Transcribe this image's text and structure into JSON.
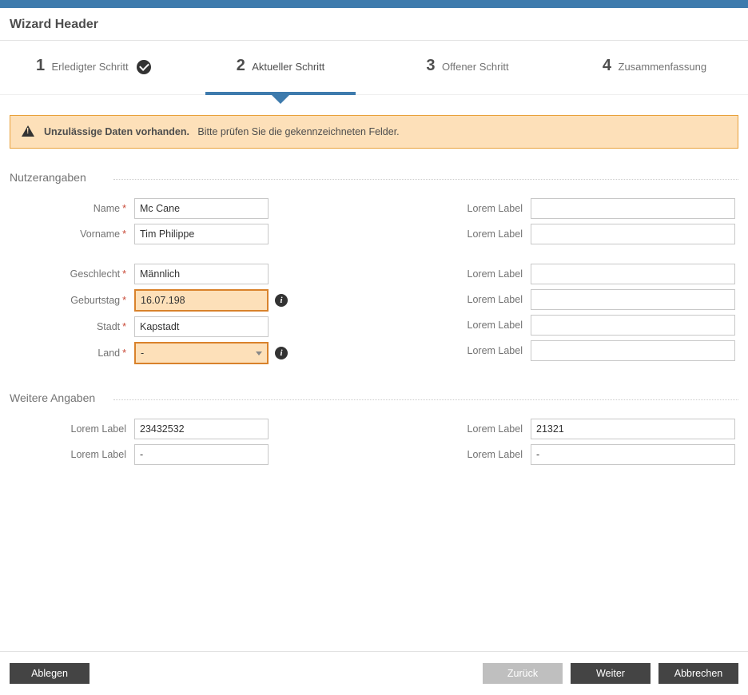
{
  "header": {
    "title": "Wizard Header"
  },
  "steps": [
    {
      "num": "1",
      "label": "Erledigter Schritt",
      "state": "done"
    },
    {
      "num": "2",
      "label": "Aktueller Schritt",
      "state": "current"
    },
    {
      "num": "3",
      "label": "Offener Schritt",
      "state": "open"
    },
    {
      "num": "4",
      "label": "Zusammenfassung",
      "state": "open"
    }
  ],
  "alert": {
    "title": "Unzulässige Daten vorhanden.",
    "text": "Bitte prüfen Sie die gekennzeichneten Felder."
  },
  "sections": {
    "user": {
      "title": "Nutzerangaben",
      "fields": {
        "name": {
          "label": "Name",
          "value": "Mc Cane",
          "required": true
        },
        "vorname": {
          "label": "Vorname",
          "value": "Tim Philippe",
          "required": true
        },
        "geschlecht": {
          "label": "Geschlecht",
          "value": "Männlich",
          "required": true
        },
        "geburtstag": {
          "label": "Geburtstag",
          "value": "16.07.198",
          "required": true,
          "error": true
        },
        "stadt": {
          "label": "Stadt",
          "value": "Kapstadt",
          "required": true
        },
        "land": {
          "label": "Land",
          "value": "-",
          "required": true,
          "error": true
        }
      },
      "lorem_label": "Lorem Label",
      "lorem_values": [
        "",
        "",
        "",
        "",
        "",
        ""
      ]
    },
    "other": {
      "title": "Weitere Angaben",
      "lorem_label": "Lorem Label",
      "left": [
        "23432532",
        "-"
      ],
      "right": [
        "21321",
        "-"
      ]
    }
  },
  "buttons": {
    "store": "Ablegen",
    "back": "Zurück",
    "next": "Weiter",
    "cancel": "Abbrechen"
  }
}
